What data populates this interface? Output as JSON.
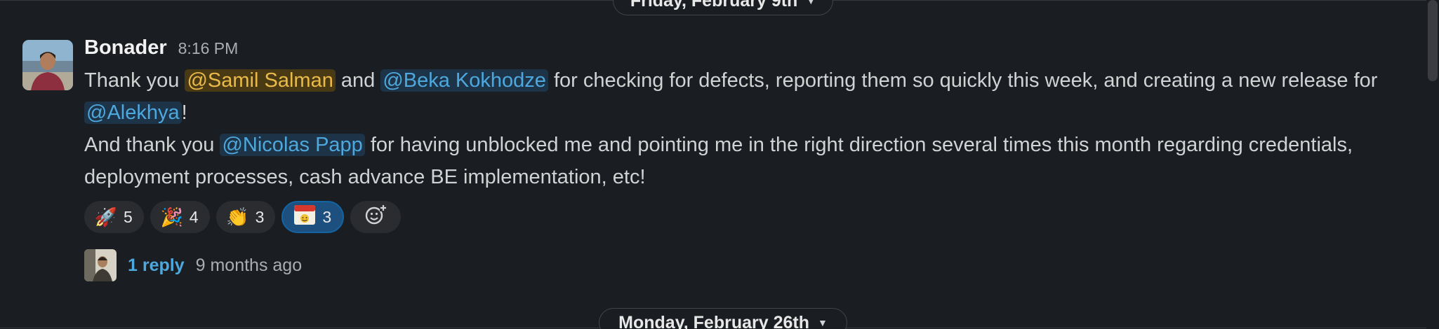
{
  "dividers": {
    "top": "Friday, February 9th",
    "bottom": "Monday, February 26th"
  },
  "message": {
    "author": "Bonader",
    "time": "8:16 PM",
    "line1": {
      "t1": "Thank you ",
      "m1": "@Samil Salman",
      "t2": " and ",
      "m2": "@Beka Kokhodze",
      "t3": " for checking for defects, reporting them so quickly this week, and creating a new release for ",
      "m3": "@Alekhya",
      "t4": "!"
    },
    "line2": {
      "t1": "And thank you ",
      "m1": "@Nicolas Papp",
      "t2": " for having unblocked me and pointing me in the right direction several times this month regarding credentials, deployment processes, cash advance BE implementation, etc!"
    }
  },
  "reactions": [
    {
      "emoji": "🚀",
      "count": "5",
      "icon": "rocket-icon"
    },
    {
      "emoji": "🎉",
      "count": "4",
      "icon": "party-popper-icon"
    },
    {
      "emoji": "👏",
      "count": "3",
      "icon": "clapping-hands-icon"
    },
    {
      "emoji": "THANK YOU",
      "count": "3",
      "icon": "thank-you-icon",
      "active": true
    }
  ],
  "thread": {
    "reply_count": "1 reply",
    "age": "9 months ago"
  },
  "colors": {
    "background": "#1a1d21",
    "mention": "#4ea8de",
    "self_mention": "#e9b949",
    "active_reaction": "#1d4f7f"
  }
}
